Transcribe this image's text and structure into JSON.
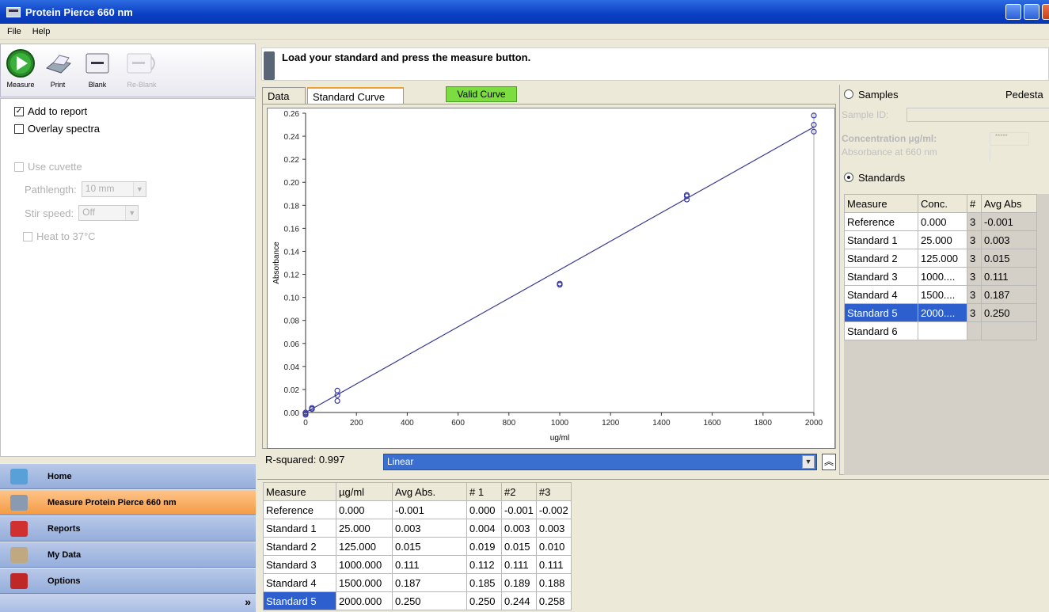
{
  "window": {
    "title": "Protein Pierce 660 nm"
  },
  "menu": [
    "File",
    "Help"
  ],
  "toolbar": [
    {
      "label": "Measure",
      "icon": "play-icon",
      "enabled": true
    },
    {
      "label": "Print",
      "icon": "printer-icon",
      "enabled": true
    },
    {
      "label": "Blank",
      "icon": "blank-icon",
      "enabled": true
    },
    {
      "label": "Re-Blank",
      "icon": "reblank-icon",
      "enabled": false
    }
  ],
  "options": {
    "add_to_report": {
      "label": "Add to report",
      "checked": true
    },
    "overlay_spectra": {
      "label": "Overlay spectra",
      "checked": false
    },
    "use_cuvette": {
      "label": "Use cuvette",
      "checked": false
    },
    "pathlength": {
      "label": "Pathlength:",
      "value": "10 mm"
    },
    "stir_speed": {
      "label": "Stir speed:",
      "value": "Off"
    },
    "heat": {
      "label": "Heat to 37°C",
      "checked": false
    }
  },
  "nav": [
    {
      "label": "Home",
      "icon": "home-icon",
      "color": "#5aa0d8"
    },
    {
      "label": "Measure Protein Pierce 660 nm",
      "icon": "measure-icon",
      "color": "#8a9ab0",
      "active": true
    },
    {
      "label": "Reports",
      "icon": "reports-icon",
      "color": "#d03030"
    },
    {
      "label": "My Data",
      "icon": "mydata-icon",
      "color": "#c0a880"
    },
    {
      "label": "Options",
      "icon": "options-icon",
      "color": "#c02828"
    }
  ],
  "instruction": "Load your standard and press the measure button.",
  "tabs": {
    "data": "Data",
    "standard_curve": "Standard Curve"
  },
  "valid_badge": "Valid Curve",
  "r_squared": "R-squared: 0.997",
  "fit_type": "Linear",
  "right_panel": {
    "samples_label": "Samples",
    "pedestal_label": "Pedesta",
    "sample_id_label": "Sample ID:",
    "concentration_label": "Concentration µg/ml:",
    "concentration_value": "*****",
    "absorbance_label": "Absorbance at 660 nm",
    "standards_label": "Standards",
    "columns": [
      "Measure",
      "Conc.",
      "#",
      "Avg Abs"
    ],
    "rows": [
      [
        "Reference",
        "0.000",
        "3",
        "-0.001"
      ],
      [
        "Standard 1",
        "25.000",
        "3",
        "0.003"
      ],
      [
        "Standard 2",
        "125.000",
        "3",
        "0.015"
      ],
      [
        "Standard 3",
        "1000....",
        "3",
        "0.111"
      ],
      [
        "Standard 4",
        "1500....",
        "3",
        "0.187"
      ],
      [
        "Standard 5",
        "2000....",
        "3",
        "0.250"
      ],
      [
        "Standard 6",
        "",
        "",
        ""
      ]
    ],
    "selected_row": 5
  },
  "bottom_table": {
    "columns": [
      "Measure",
      "µg/ml",
      "Avg Abs.",
      "# 1",
      "#2",
      "#3"
    ],
    "rows": [
      [
        "Reference",
        "0.000",
        "-0.001",
        "0.000",
        "-0.001",
        "-0.002"
      ],
      [
        "Standard 1",
        "25.000",
        "0.003",
        "0.004",
        "0.003",
        "0.003"
      ],
      [
        "Standard 2",
        "125.000",
        "0.015",
        "0.019",
        "0.015",
        "0.010"
      ],
      [
        "Standard 3",
        "1000.000",
        "0.111",
        "0.112",
        "0.111",
        "0.111"
      ],
      [
        "Standard 4",
        "1500.000",
        "0.187",
        "0.185",
        "0.189",
        "0.188"
      ],
      [
        "Standard 5",
        "2000.000",
        "0.250",
        "0.250",
        "0.244",
        "0.258"
      ]
    ],
    "selected_row": 5
  },
  "chart_data": {
    "type": "scatter",
    "xlabel": "ug/ml",
    "ylabel": "Absorbance",
    "xlim": [
      0,
      2000
    ],
    "ylim": [
      0,
      0.26
    ],
    "xticks": [
      "0",
      "200",
      "400",
      "600",
      "800",
      "1000",
      "1200",
      "1400",
      "1600",
      "1800",
      "2000"
    ],
    "yticks": [
      "0.00",
      "0.02",
      "0.04",
      "0.06",
      "0.08",
      "0.10",
      "0.12",
      "0.14",
      "0.16",
      "0.18",
      "0.20",
      "0.22",
      "0.24",
      "0.26"
    ],
    "points": [
      [
        0,
        0.0
      ],
      [
        0,
        -0.001
      ],
      [
        0,
        -0.002
      ],
      [
        25,
        0.004
      ],
      [
        25,
        0.003
      ],
      [
        25,
        0.003
      ],
      [
        125,
        0.019
      ],
      [
        125,
        0.015
      ],
      [
        125,
        0.01
      ],
      [
        1000,
        0.112
      ],
      [
        1000,
        0.111
      ],
      [
        1000,
        0.111
      ],
      [
        1500,
        0.185
      ],
      [
        1500,
        0.189
      ],
      [
        1500,
        0.188
      ],
      [
        2000,
        0.25
      ],
      [
        2000,
        0.244
      ],
      [
        2000,
        0.258
      ]
    ],
    "fit_line": [
      [
        0,
        0.0
      ],
      [
        2000,
        0.248
      ]
    ],
    "point_color": "#3a3aa0",
    "line_color": "#3a3a90"
  }
}
